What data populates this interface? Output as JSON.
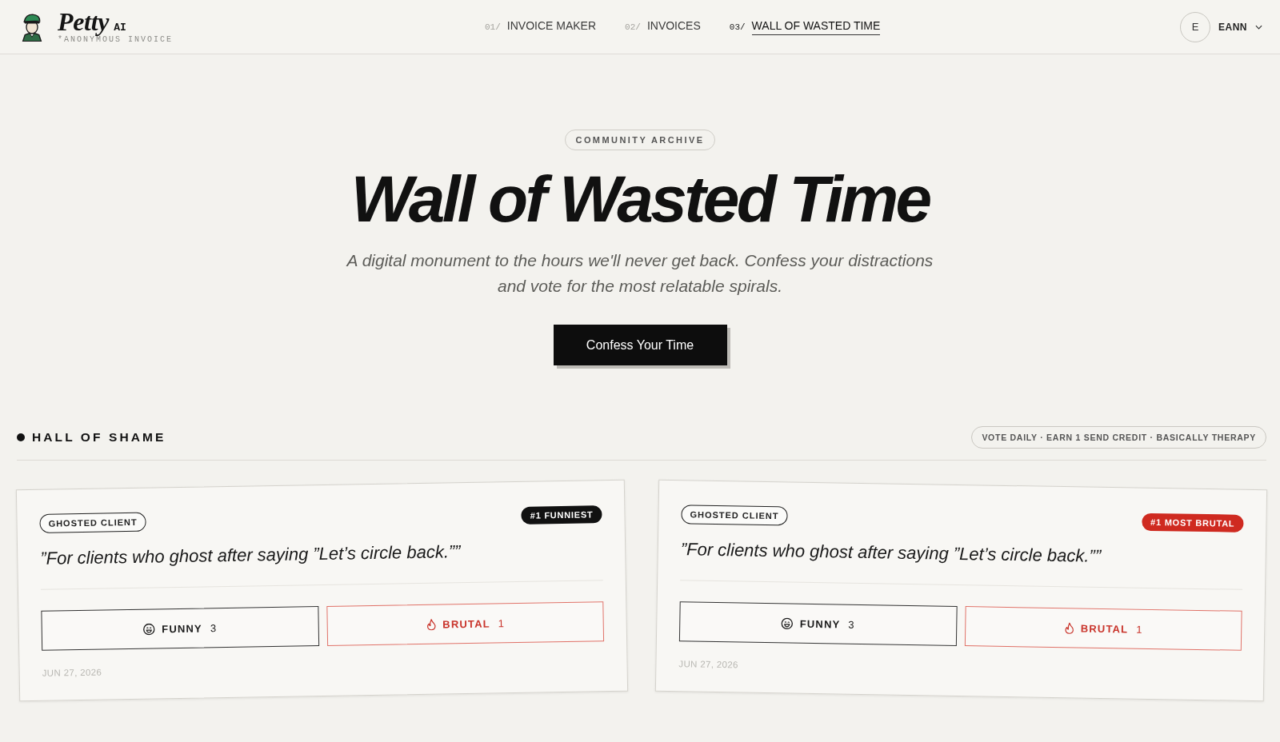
{
  "header": {
    "logo": {
      "name": "Petty",
      "suffix": "AI",
      "tagline": "*ANONYMOUS INVOICE"
    },
    "nav": [
      {
        "number": "01/",
        "label": "INVOICE MAKER",
        "selected": false
      },
      {
        "number": "02/",
        "label": "INVOICES",
        "selected": false
      },
      {
        "number": "03/",
        "label": "WALL OF WASTED TIME",
        "selected": true
      }
    ],
    "user": {
      "initial": "E",
      "name": "EANN"
    }
  },
  "hero": {
    "eyebrow": "COMMUNITY ARCHIVE",
    "title": "Wall of Wasted Time",
    "subtitle": "A digital monument to the hours we'll never get back. Confess your distractions and vote for the most relatable spirals.",
    "button": "Confess Your Time"
  },
  "hall_of_shame": {
    "title": "HALL OF SHAME",
    "note": "VOTE DAILY · EARN 1 SEND CREDIT · BASICALLY THERAPY",
    "cards": [
      {
        "tag": "GHOSTED CLIENT",
        "badge": {
          "kind": "funny",
          "label": "#1 FUNNIEST"
        },
        "quote": "”For clients who ghost after saying ”Let’s circle back.””",
        "votes": [
          {
            "kind": "funny",
            "label": "FUNNY",
            "count": "3"
          },
          {
            "kind": "brutal",
            "label": "BRUTAL",
            "count": "1"
          }
        ],
        "date": "JUN 27, 2026"
      },
      {
        "tag": "GHOSTED CLIENT",
        "badge": {
          "kind": "brutal",
          "label": "#1 MOST BRUTAL"
        },
        "quote": "”For clients who ghost after saying ”Let’s circle back.””",
        "votes": [
          {
            "kind": "funny",
            "label": "FUNNY",
            "count": "3"
          },
          {
            "kind": "brutal",
            "label": "BRUTAL",
            "count": "1"
          }
        ],
        "date": "JUN 27, 2026"
      }
    ]
  }
}
